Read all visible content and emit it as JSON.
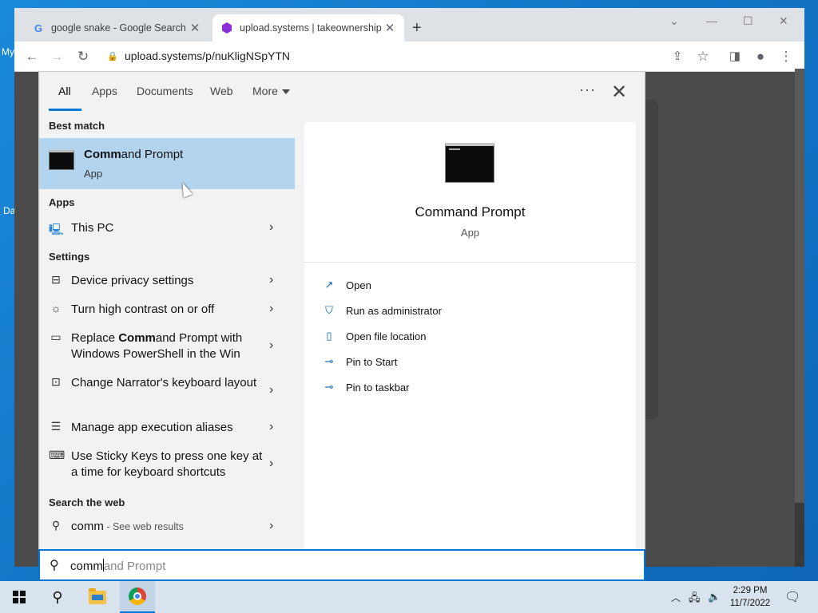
{
  "desktop": {
    "labels": [
      "My",
      "Da"
    ]
  },
  "browser": {
    "tabs": [
      {
        "title": "google snake - Google Search",
        "favicon": "G",
        "active": false
      },
      {
        "title": "upload.systems | takeownership",
        "favicon": "hexagon",
        "active": true
      }
    ],
    "new_tab": "+",
    "window_controls": {
      "minimize": "—",
      "maximize": "☐",
      "close": "✕",
      "tab_search": "⌄"
    },
    "url": "upload.systems/p/nuKligNSpYTN"
  },
  "search": {
    "filters": [
      "All",
      "Apps",
      "Documents",
      "Web",
      "More"
    ],
    "active_filter": "All",
    "sections": {
      "best_match": "Best match",
      "apps": "Apps",
      "settings": "Settings",
      "web": "Search the web"
    },
    "best_match": {
      "name_bold": "Comm",
      "name_rest": "and Prompt",
      "type": "App"
    },
    "apps": [
      {
        "label": "This PC",
        "icon": "pc-icon"
      }
    ],
    "settings": [
      {
        "label": "Device privacy settings",
        "icon": "device-icon"
      },
      {
        "label": "Turn high contrast on or off",
        "icon": "brightness-icon"
      },
      {
        "prefix": "Replace ",
        "bold": "Comm",
        "suffix": "and Prompt with Windows PowerShell in the Win",
        "icon": "keyboard-icon"
      },
      {
        "label": "Change Narrator's keyboard layout",
        "icon": "narrator-icon"
      },
      {
        "label": "Manage app execution aliases",
        "icon": "list-icon"
      },
      {
        "label": "Use Sticky Keys to press one key at a time for keyboard shortcuts",
        "icon": "keyboard-icon"
      }
    ],
    "web": {
      "query": "comm",
      "hint": " - See web results"
    },
    "detail": {
      "name": "Command Prompt",
      "type": "App",
      "actions": [
        "Open",
        "Run as administrator",
        "Open file location",
        "Pin to Start",
        "Pin to taskbar"
      ]
    },
    "box": {
      "typed": "comm",
      "suggestion": "and Prompt"
    }
  },
  "taskbar": {
    "time": "2:29 PM",
    "date": "11/7/2022"
  }
}
